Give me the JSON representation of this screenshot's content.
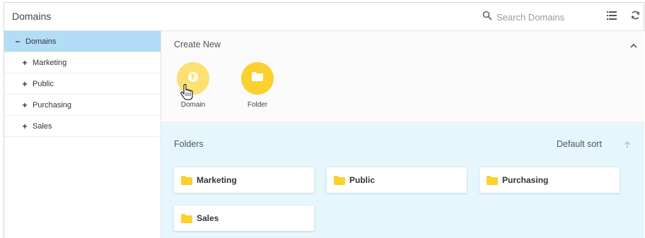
{
  "header": {
    "title": "Domains",
    "search_placeholder": "Search Domains"
  },
  "sidebar": {
    "items": [
      {
        "sign": "−",
        "label": "Domains"
      },
      {
        "sign": "+",
        "label": "Marketing"
      },
      {
        "sign": "+",
        "label": "Public"
      },
      {
        "sign": "+",
        "label": "Purchasing"
      },
      {
        "sign": "+",
        "label": "Sales"
      }
    ]
  },
  "create_new": {
    "heading": "Create New",
    "tiles": [
      {
        "label": "Domain",
        "icon": "globe-icon"
      },
      {
        "label": "Folder",
        "icon": "folder-icon"
      }
    ]
  },
  "folders": {
    "heading": "Folders",
    "sort_label": "Default sort",
    "items": [
      "Marketing",
      "Public",
      "Purchasing",
      "Sales"
    ]
  },
  "colors": {
    "selected_bg": "#b3dcf7",
    "folders_bg": "#e5f6fc",
    "accent_yellow": "#fbd02f",
    "domain_yellow": "#fce172"
  }
}
